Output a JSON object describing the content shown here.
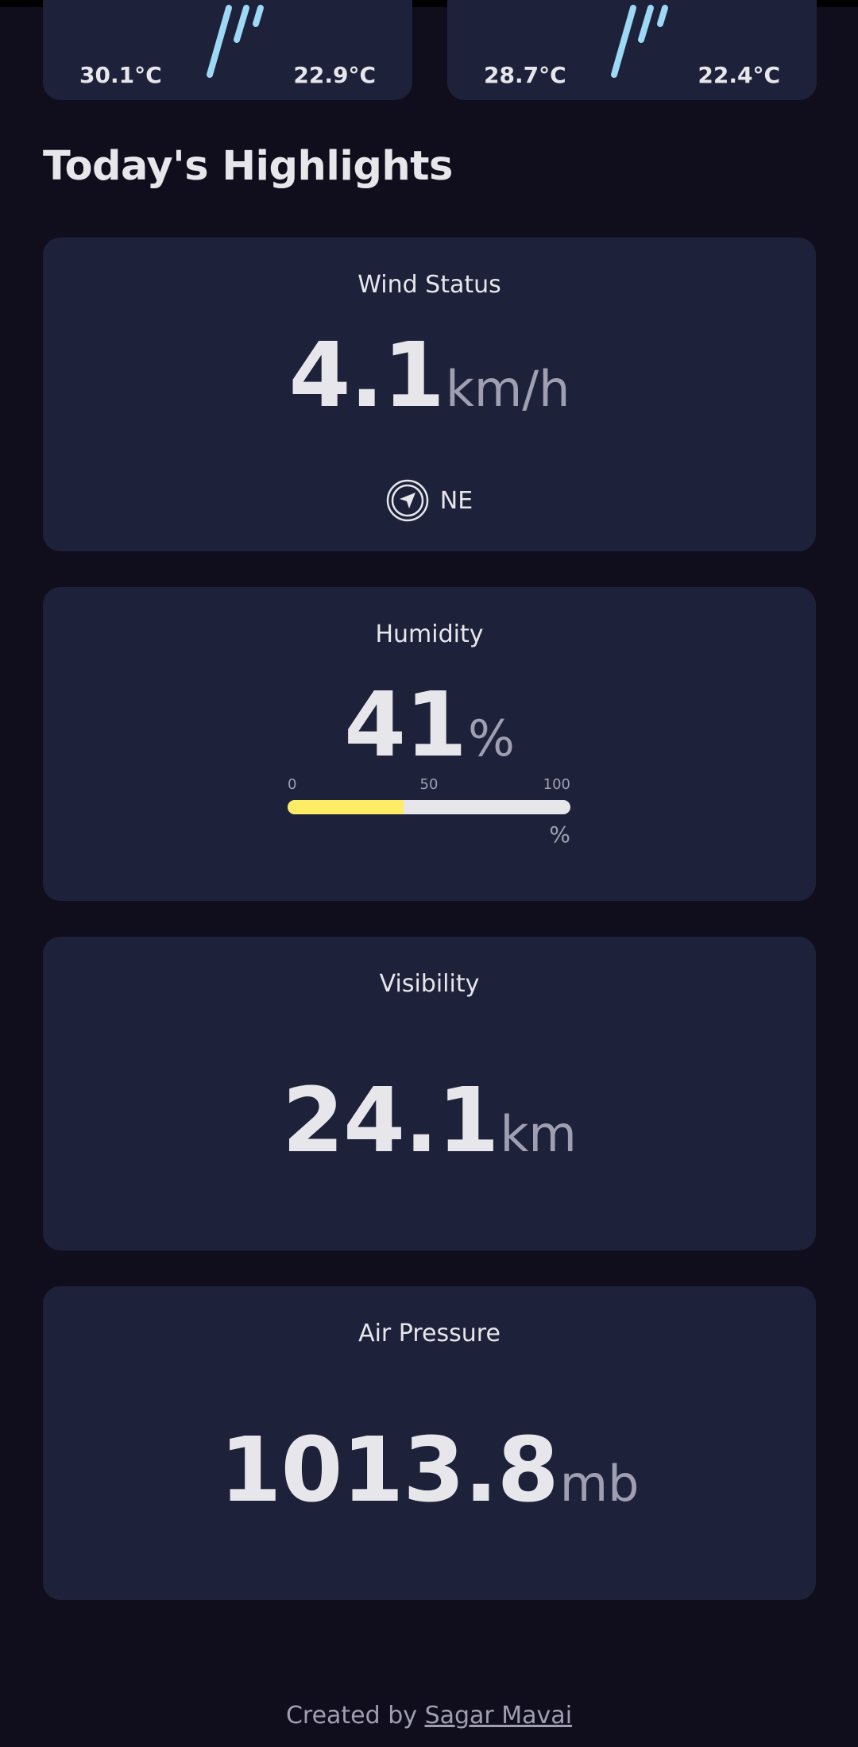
{
  "forecast": [
    {
      "max_temp": "30.1°C",
      "min_temp": "22.9°C",
      "icon": "rain-icon"
    },
    {
      "max_temp": "28.7°C",
      "min_temp": "22.4°C",
      "icon": "rain-icon"
    }
  ],
  "highlights": {
    "title": "Today's Highlights",
    "wind": {
      "label": "Wind Status",
      "value": "4.1",
      "unit": "km/h",
      "direction": "NE",
      "icon": "compass-navigation-icon"
    },
    "humidity": {
      "label": "Humidity",
      "value": "41",
      "unit": "%",
      "percent": 41,
      "scale": {
        "min": "0",
        "mid": "50",
        "max": "100",
        "unit": "%"
      }
    },
    "visibility": {
      "label": "Visibility",
      "value": "24.1",
      "unit": "km"
    },
    "pressure": {
      "label": "Air Pressure",
      "value": "1013.8",
      "unit": "mb"
    }
  },
  "footer": {
    "prefix": "Created by ",
    "author": "Sagar Mavai"
  },
  "colors": {
    "background": "#100e1d",
    "card": "#1e213a",
    "text": "#e7e7eb",
    "muted": "#a09fb1",
    "accent": "#ffec65",
    "rain": "#9dd8f5"
  }
}
